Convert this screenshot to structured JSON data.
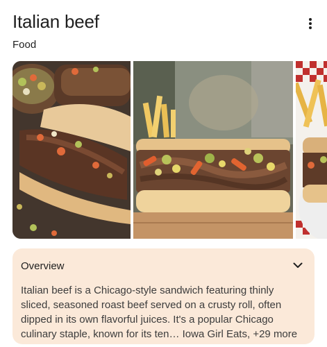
{
  "header": {
    "title": "Italian beef",
    "subtitle": "Food",
    "more_icon": "more-vert-icon"
  },
  "gallery": {
    "images": [
      {
        "alt": "Italian beef sandwich with giardiniera on a dark board"
      },
      {
        "alt": "Italian beef sandwich with giardiniera and fries"
      },
      {
        "alt": "Italian beef sandwich on red checkered paper with fries"
      }
    ]
  },
  "overview": {
    "title": "Overview",
    "expand_icon": "chevron-down-icon",
    "text": "Italian beef is a Chicago-style sandwich featuring thinly sliced, seasoned roast beef served on a crusty roll, often dipped in its own flavorful juices. It's a popular Chicago culinary staple, known for its ten",
    "truncation": "…",
    "source": "Iowa Girl Eats",
    "more_sources": "+29 more"
  },
  "colors": {
    "overview_bg": "#fbe9d9",
    "text": "#1f1f1f"
  }
}
